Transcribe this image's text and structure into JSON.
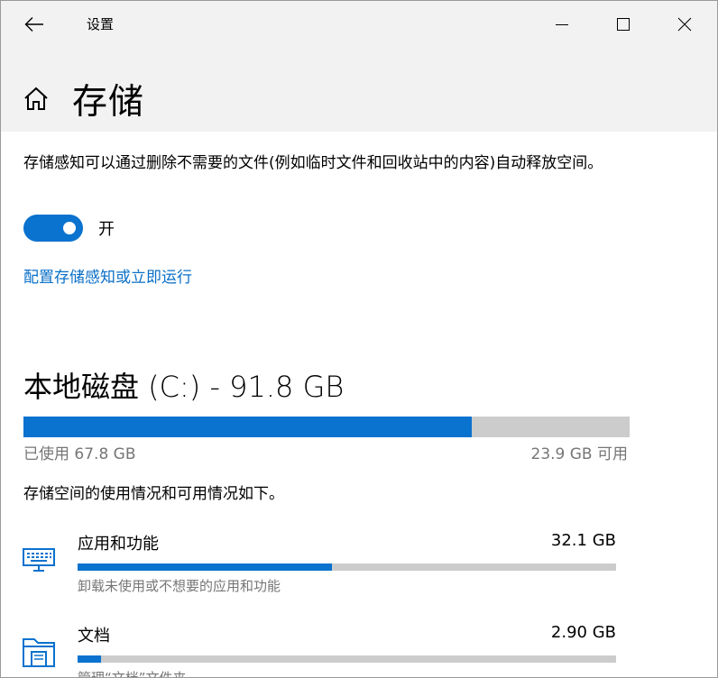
{
  "window": {
    "title": "设置"
  },
  "page": {
    "title": "存储"
  },
  "storage_sense": {
    "description": "存储感知可以通过删除不需要的文件(例如临时文件和回收站中的内容)自动释放空间。",
    "toggle_state": "开",
    "toggle_on": true,
    "configure_link": "配置存储感知或立即运行"
  },
  "disk": {
    "title": "本地磁盘 (C:) - 91.8 GB",
    "used_label": "已使用 67.8 GB",
    "free_label": "23.9 GB 可用",
    "used_fraction": 0.739,
    "usage_description": "存储空间的使用情况和可用情况如下。"
  },
  "categories": [
    {
      "name": "应用和功能",
      "size": "32.1 GB",
      "description": "卸载未使用或不想要的应用和功能",
      "fill_fraction": 0.473,
      "icon": "keyboard-icon"
    },
    {
      "name": "文档",
      "size": "2.90 GB",
      "description": "管理“文档”文件夹",
      "fill_fraction": 0.043,
      "icon": "folder-icon"
    }
  ],
  "colors": {
    "accent": "#0a72cf",
    "link": "#0a6fc7",
    "bar_bg": "#cccccc",
    "secondary_text": "#767676",
    "titlebar_bg": "#f2f2f2"
  }
}
